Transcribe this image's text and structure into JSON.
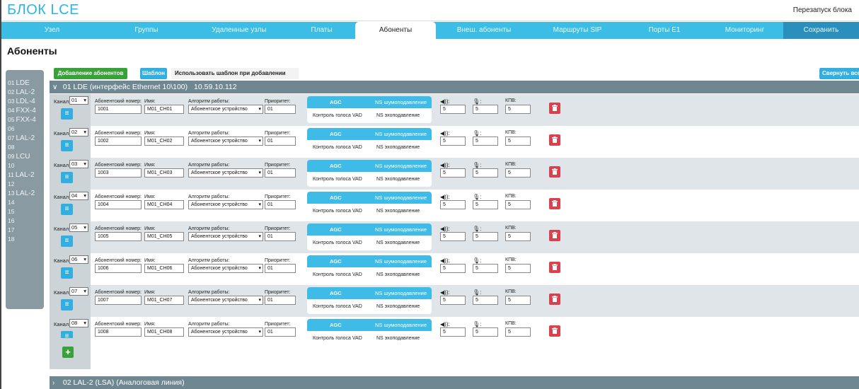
{
  "header": {
    "brand": "БЛОК LCE",
    "reboot": "Перезапуск блока"
  },
  "nav": {
    "tabs": [
      {
        "label": "Узел",
        "w": 143
      },
      {
        "label": "Группы",
        "w": 124
      },
      {
        "label": "Удаленные узлы",
        "w": 138
      },
      {
        "label": "Платы",
        "w": 95
      },
      {
        "label": "Абоненты",
        "w": 114
      },
      {
        "label": "Внеш. абоненты",
        "w": 136
      },
      {
        "label": "Маршруты SIP",
        "w": 128
      },
      {
        "label": "Порты E1",
        "w": 118
      },
      {
        "label": "Мониторинг",
        "w": 109
      },
      {
        "label": "Сохранить",
        "w": 107
      }
    ],
    "active_index": 4,
    "save_index": 9
  },
  "page_title": "Абоненты",
  "sidebar": {
    "items": [
      {
        "num": "01",
        "label": "LDE"
      },
      {
        "num": "02",
        "label": "LAL-2"
      },
      {
        "num": "03",
        "label": "LDL-4"
      },
      {
        "num": "04",
        "label": "FXX-4"
      },
      {
        "num": "05",
        "label": "FXX-4"
      },
      {
        "num": "06",
        "label": ""
      },
      {
        "num": "07",
        "label": "LAL-2"
      },
      {
        "num": "08",
        "label": ""
      },
      {
        "num": "09",
        "label": "LCU"
      },
      {
        "num": "10",
        "label": ""
      },
      {
        "num": "11",
        "label": "LAL-2"
      },
      {
        "num": "12",
        "label": ""
      },
      {
        "num": "13",
        "label": "LAL-2"
      },
      {
        "num": "14",
        "label": ""
      },
      {
        "num": "15",
        "label": ""
      },
      {
        "num": "16",
        "label": ""
      },
      {
        "num": "17",
        "label": ""
      },
      {
        "num": "18",
        "label": ""
      }
    ]
  },
  "toolbar": {
    "add_subscribers": "Добавление абонентов",
    "template": "Шаблон",
    "use_template": "Использовать шаблон при добавлении абонента",
    "collapse_all": "Свернуть все"
  },
  "group1": {
    "chevron": "∨",
    "title": "01 LDE (интерфейс Ethernet 10\\100)",
    "ip": "10.59.10.112"
  },
  "group2": {
    "chevron": "›",
    "title": "02 LAL-2 (LSA) (Аналоговая линия)"
  },
  "labels": {
    "canal": "Канал",
    "number": "Абонентский номер:",
    "name": "Имя:",
    "algo": "Алгоритм работы:",
    "priority": "Приоритет:",
    "agc": "AGC",
    "ns_suppress": "NS шумоподавление",
    "vad": "Контроль голоса VAD",
    "ns_echo": "NS эхоподавление",
    "speaker": "◀)):",
    "mic": "🎙:",
    "kpv": "КПВ:"
  },
  "rows": [
    {
      "canal": "01",
      "number": "1001",
      "name": "M01_CH01",
      "algo": "Абонентское устройство",
      "priority": "01",
      "vol": "5",
      "mic": "5",
      "kpv": "5"
    },
    {
      "canal": "02",
      "number": "1002",
      "name": "M01_CH02",
      "algo": "Абонентское устройство",
      "priority": "01",
      "vol": "5",
      "mic": "5",
      "kpv": "5"
    },
    {
      "canal": "03",
      "number": "1003",
      "name": "M01_CH03",
      "algo": "Абонентское устройство",
      "priority": "01",
      "vol": "5",
      "mic": "5",
      "kpv": "5"
    },
    {
      "canal": "04",
      "number": "1004",
      "name": "M01_CH04",
      "algo": "Абонентское устройство",
      "priority": "01",
      "vol": "5",
      "mic": "5",
      "kpv": "5"
    },
    {
      "canal": "05",
      "number": "1005",
      "name": "M01_CH05",
      "algo": "Абонентское устройство",
      "priority": "01",
      "vol": "5",
      "mic": "5",
      "kpv": "5"
    },
    {
      "canal": "06",
      "number": "1006",
      "name": "M01_CH06",
      "algo": "Абонентское устройство",
      "priority": "01",
      "vol": "5",
      "mic": "5",
      "kpv": "5"
    },
    {
      "canal": "07",
      "number": "1007",
      "name": "M01_CH07",
      "algo": "Абонентское устройство",
      "priority": "01",
      "vol": "5",
      "mic": "5",
      "kpv": "5"
    },
    {
      "canal": "08",
      "number": "1008",
      "name": "M01_CH08",
      "algo": "Абонентское устройство",
      "priority": "01",
      "vol": "5",
      "mic": "5",
      "kpv": "5"
    }
  ],
  "add_button": "+",
  "colors": {
    "accent": "#3bbde6",
    "green": "#3aa03a",
    "delete": "#d9414f",
    "group_header": "#6f8790",
    "sidebar": "#8a9aa3"
  }
}
